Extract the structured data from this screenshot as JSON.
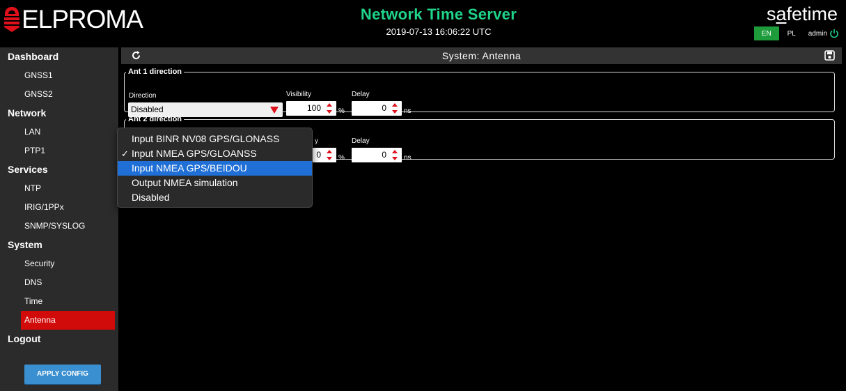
{
  "header": {
    "logo_text": "ELPROMA",
    "title": "Network Time Server",
    "datetime": "2019-07-13 16:06:22 UTC",
    "brand_prefix": "s",
    "brand_underlined": "a",
    "brand_suffix": "fetime",
    "lang_en": "EN",
    "lang_pl": "PL",
    "user": "admin"
  },
  "sidebar": {
    "dashboard": "Dashboard",
    "gnss1": "GNSS1",
    "gnss2": "GNSS2",
    "network": "Network",
    "lan": "LAN",
    "ptp1": "PTP1",
    "services": "Services",
    "ntp": "NTP",
    "irig": "IRIG/1PPx",
    "snmp": "SNMP/SYSLOG",
    "system": "System",
    "security": "Security",
    "dns": "DNS",
    "time": "Time",
    "antenna": "Antenna",
    "logout": "Logout",
    "apply": "APPLY CONFIG"
  },
  "page": {
    "title": "System: Antenna"
  },
  "ant1": {
    "legend": "Ant 1 direction",
    "direction_label": "Direction",
    "direction_value": "Disabled",
    "visibility_label": "Visibility",
    "visibility_value": "100",
    "visibility_unit": "%",
    "delay_label": "Delay",
    "delay_value": "0",
    "delay_unit": "ns"
  },
  "ant2": {
    "legend": "Ant 2 direction",
    "visibility_label": "y",
    "visibility_value": "0",
    "visibility_unit": "%",
    "delay_label": "Delay",
    "delay_value": "0",
    "delay_unit": "ns"
  },
  "dropdown": {
    "checkmark": "✓",
    "options": [
      "Input BINR NV08 GPS/GLONASS",
      "Input NMEA GPS/GLOANSS",
      "Input NMEA GPS/BEIDOU",
      "Output NMEA simulation",
      "Disabled"
    ]
  },
  "colors": {
    "accent_green": "#1fd48a",
    "active_red": "#d10a0a",
    "highlight_blue": "#1f6fd6",
    "apply_blue": "#3a8fd0"
  }
}
